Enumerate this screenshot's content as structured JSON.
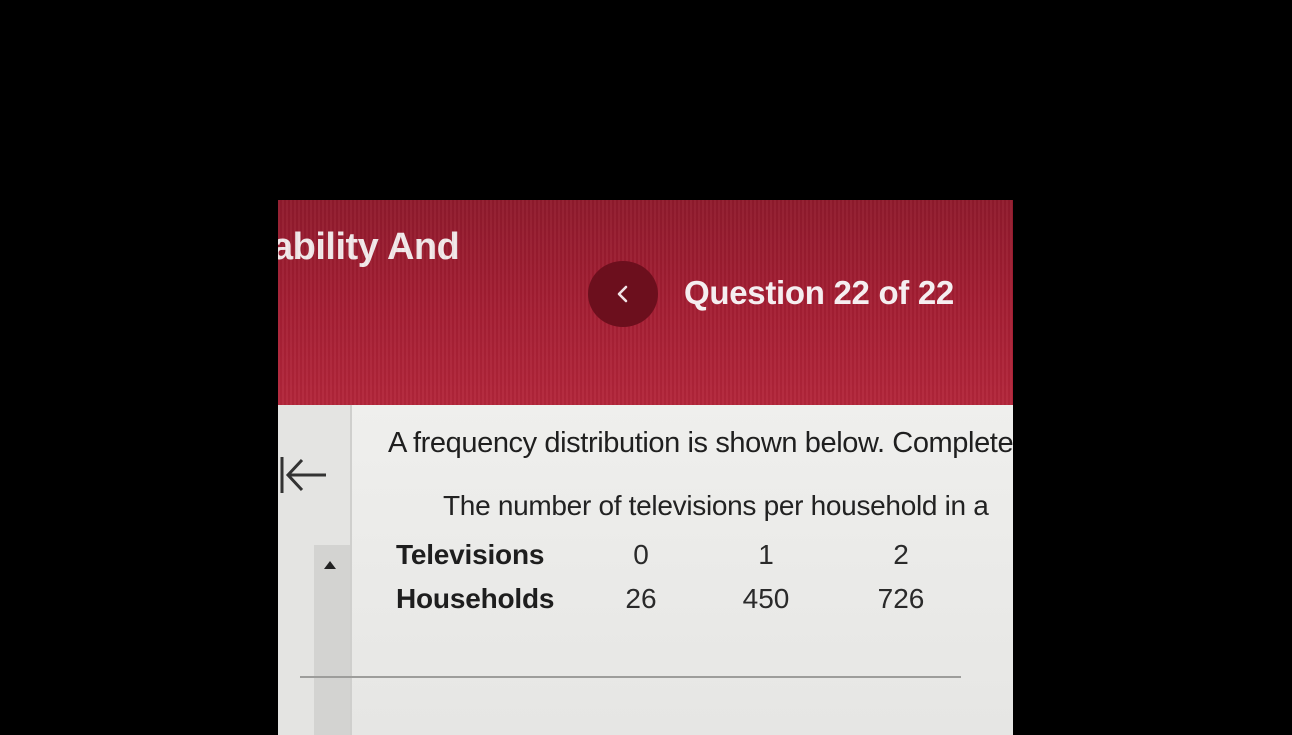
{
  "header": {
    "course_title": "ability And",
    "question_counter": "Question 22 of 22",
    "prev_icon": "chevron-left-icon",
    "brand_color": "#a21d32"
  },
  "left_rail": {
    "back_icon": "arrow-left-bar-icon",
    "scroll_icon": "triangle-up-icon"
  },
  "question": {
    "prompt": "A frequency distribution is shown below. Complete",
    "table_caption": "The number of televisions per household in a",
    "table": {
      "row_headers": [
        "Televisions",
        "Households"
      ],
      "televisions": [
        "0",
        "1",
        "2"
      ],
      "households": [
        "26",
        "450",
        "726"
      ]
    }
  }
}
